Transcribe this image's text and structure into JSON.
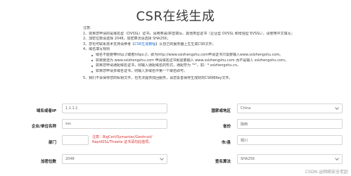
{
  "title": "CSR在线生成",
  "notes": {
    "heading": "注意:",
    "lines": [
      "1、如果您申请的是域名型（DVSSL）证书，请用英语/拼音填写。其他类型证书（企业型 OVSSL 和增强型 EVSSL），请使用中文填写；",
      "2、加密位数请选择 2048，加密算法请选择 SHA256；",
      "4、域名填写规则"
    ],
    "line3_prefix": "3、您也可联系技术支持请参考【",
    "line3_link": "CSR生成教程",
    "line3_suffix": "】从自己的服务器上生生成CSR文件；",
    "rules": [
      "域名不能要带http://或者https://，即为http://www.sslzhengshu.com申请证书只需要输入www.sslzhengshu.com。",
      "如果要选为 www.sslzhengshu.com 申请域名证书就需要输入 www.sslzhengshu.com 而不是输入 sslzhengshu.com。",
      "如果您申请通配域名证书，则输入通配域名的形式，通配符为 \"*\"，如：*.sslzhengshu.cn。",
      "如果您申请多域名证书，则输入多域名中第一个域名即可。"
    ],
    "line5": "5、我们不会保存您的私钥文件，也无法提供找回服务，请您妥善保存生成好的CSR和Key文件。"
  },
  "form": {
    "domain_label": "域名或者IP",
    "domain_value": "1.1.1.1",
    "org_label": "企业/单位名称",
    "org_value": "sss",
    "dept_label": "部门",
    "dept_value": "",
    "dept_hint_line1": "注意：BigCert/Symantec/Geotrust/",
    "dept_hint_line2": "RapidSSL/Thawte 证书请勿此值项。",
    "bits_label": "加密位数",
    "bits_value": "2048",
    "country_label": "国家或地区",
    "country_value": "China",
    "province_label": "省份",
    "province_value": "陕西",
    "city_label": "市/县",
    "city_value": "铜川",
    "algo_label": "签名算法",
    "algo_value": "SHA256"
  },
  "footer": "CSDN @网络安全老赵"
}
